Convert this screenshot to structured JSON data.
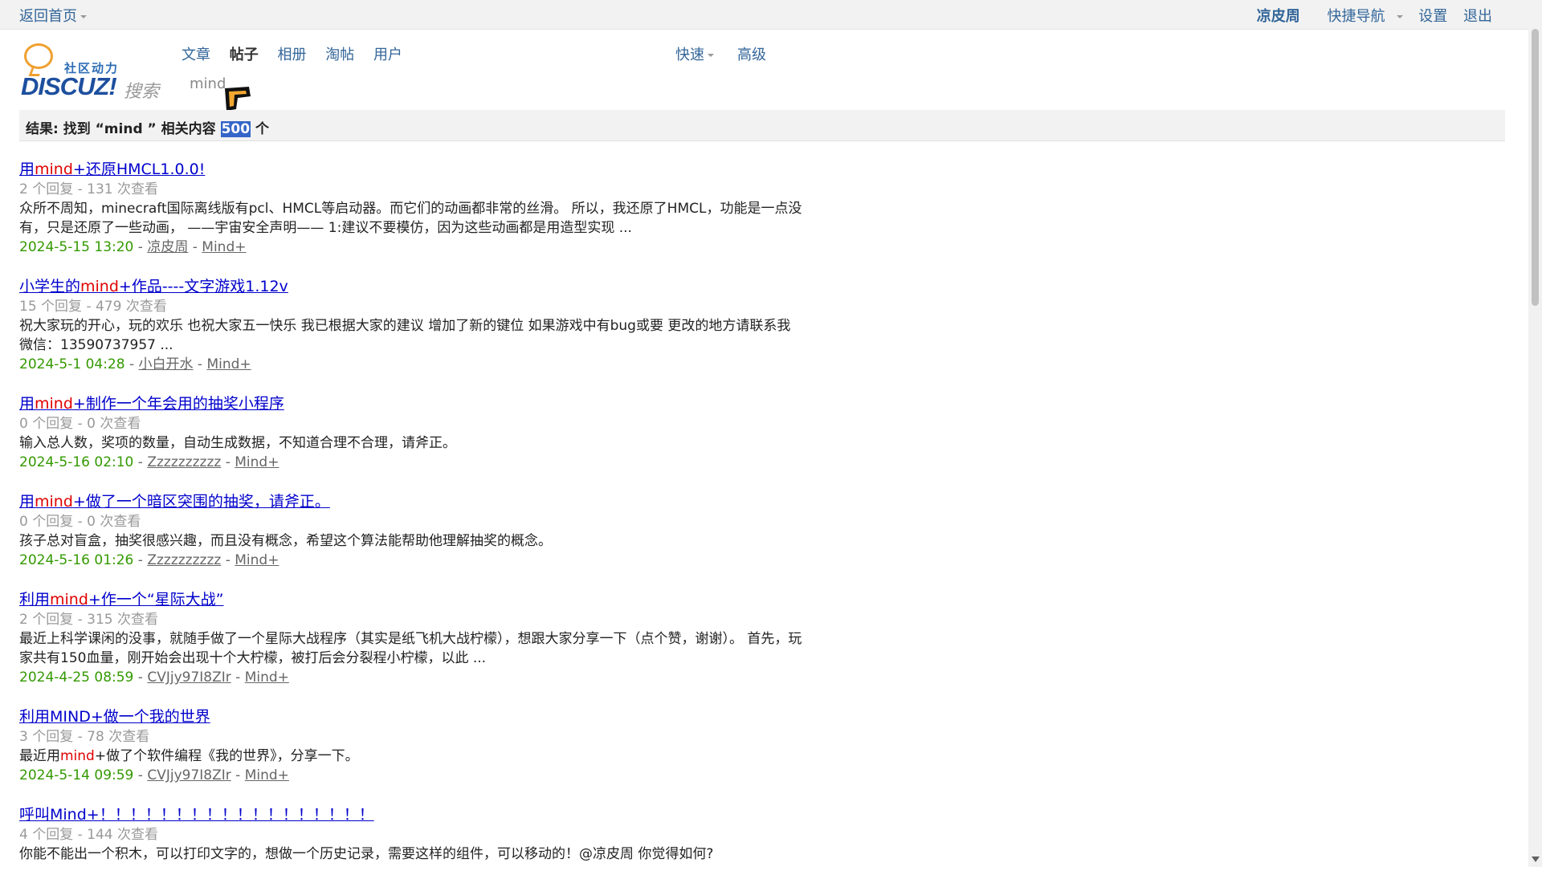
{
  "topbar": {
    "home_label": "返回首页",
    "user": "凉皮周",
    "quick_nav": "快捷导航",
    "settings": "设置",
    "logout": "退出"
  },
  "logo": {
    "cn": "社区动力",
    "en": "DISCUZ!",
    "search_word": "搜索"
  },
  "tabs": [
    {
      "label": "文章"
    },
    {
      "label": "帖子"
    },
    {
      "label": "相册"
    },
    {
      "label": "淘帖"
    },
    {
      "label": "用户"
    }
  ],
  "quick_label": "快速",
  "advanced_label": "高级",
  "search": {
    "value": "mind"
  },
  "results": {
    "prefix": "结果: 找到 “mind ” 相关内容 ",
    "count": "500",
    "suffix": " 个"
  },
  "items": [
    {
      "title_pre": "用",
      "title_kw": "mind",
      "title_post": "+还原HMCL1.0.0! ",
      "stats": "2 个回复 - 131 次查看",
      "summary_pre": "众所不周知，minecraft国际离线版有pcl、HMCL等启动器。而它们的动画都非常的丝滑。 所以，我还原了HMCL，功能是一点没有，只是还原了一些动画， ——宇宙安全声明—— 1:建议不要模仿，因为这些动画都是用造型实现 ...",
      "summary_kw": "",
      "summary_post": "",
      "date": "2024-5-15 13:20",
      "author": "凉皮周",
      "forum": "Mind+"
    },
    {
      "title_pre": "小学生的",
      "title_kw": "mind",
      "title_post": "+作品----文字游戏1.12v",
      "stats": "15 个回复 - 479 次查看",
      "summary_pre": "祝大家玩的开心，玩的欢乐 也祝大家五一快乐 我已根据大家的建议 增加了新的键位 如果游戏中有bug或要 更改的地方请联系我 微信：13590737957 ...",
      "summary_kw": "",
      "summary_post": "",
      "date": "2024-5-1 04:28",
      "author": "小白开水",
      "forum": "Mind+"
    },
    {
      "title_pre": "用",
      "title_kw": "mind",
      "title_post": "+制作一个年会用的抽奖小程序",
      "stats": "0 个回复 - 0 次查看",
      "summary_pre": "输入总人数，奖项的数量，自动生成数据，不知道合理不合理，请斧正。",
      "summary_kw": "",
      "summary_post": "",
      "date": "2024-5-16 02:10",
      "author": "Zzzzzzzzzz",
      "forum": "Mind+"
    },
    {
      "title_pre": "用",
      "title_kw": "mind",
      "title_post": "+做了一个暗区突围的抽奖，请斧正。",
      "stats": "0 个回复 - 0 次查看",
      "summary_pre": "孩子总对盲盒，抽奖很感兴趣，而且没有概念，希望这个算法能帮助他理解抽奖的概念。",
      "summary_kw": "",
      "summary_post": "",
      "date": "2024-5-16 01:26",
      "author": "Zzzzzzzzzz",
      "forum": "Mind+"
    },
    {
      "title_pre": "利用",
      "title_kw": "mind",
      "title_post": "+作一个“星际大战”",
      "stats": "2 个回复 - 315 次查看",
      "summary_pre": "最近上科学课闲的没事，就随手做了一个星际大战程序（其实是纸飞机大战柠檬），想跟大家分享一下（点个赞，谢谢）。 首先，玩家共有150血量，刚开始会出现十个大柠檬，被打后会分裂程小柠檬，以此 ...",
      "summary_kw": "",
      "summary_post": "",
      "date": "2024-4-25 08:59",
      "author": "CVJjy97I8ZIr",
      "forum": "Mind+"
    },
    {
      "title_pre": "利用MIND+做一个我的世界",
      "title_kw": "",
      "title_post": "",
      "stats": "3 个回复 - 78 次查看",
      "summary_pre": "最近用",
      "summary_kw": "mind",
      "summary_post": "+做了个软件编程《我的世界》，分享一下。",
      "date": "2024-5-14 09:59",
      "author": "CVJjy97I8ZIr",
      "forum": "Mind+"
    },
    {
      "title_pre": "呼叫Mind+！！！！！！！！！！！！！！！！！！",
      "title_kw": "",
      "title_post": "",
      "stats": "4 个回复 - 144 次查看",
      "summary_pre": "你能不能出一个积木，可以打印文字的，想做一个历史记录，需要这样的组件，可以移动的！@凉皮周 你觉得如何?",
      "summary_kw": "",
      "summary_post": "",
      "date": "",
      "author": "",
      "forum": ""
    }
  ]
}
